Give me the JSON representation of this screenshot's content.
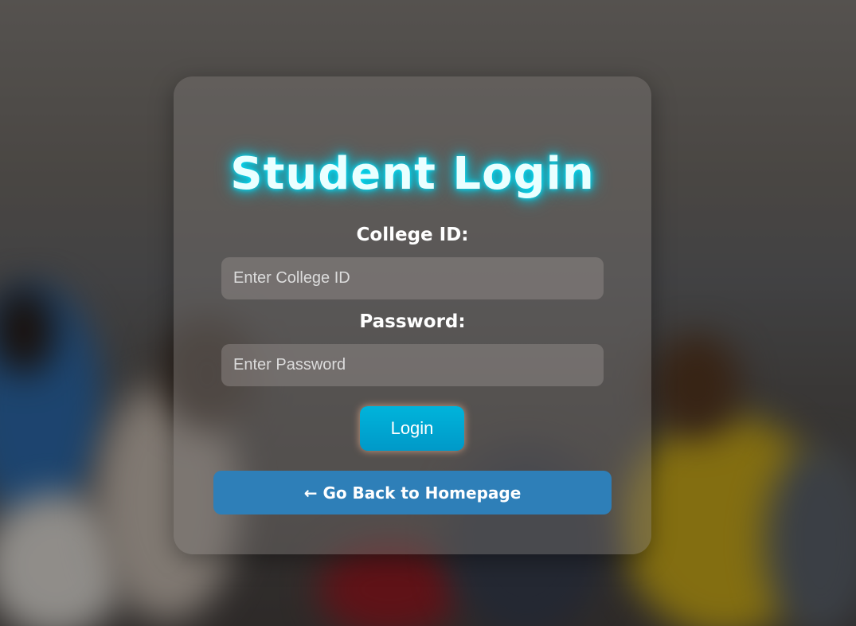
{
  "login": {
    "title": "Student Login",
    "college_id_label": "College ID:",
    "college_id_placeholder": "Enter College ID",
    "college_id_value": "",
    "password_label": "Password:",
    "password_placeholder": "Enter Password",
    "password_value": "",
    "login_button": "Login",
    "back_button": "← Go Back to Homepage"
  },
  "colors": {
    "title_glow": "#00e5ff",
    "login_button": "#00a8d6",
    "back_button": "#2e7fb8"
  }
}
